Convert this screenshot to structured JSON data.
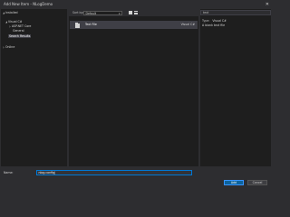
{
  "window": {
    "title": "Add New Item - NLogDemo",
    "close_glyph": "✕"
  },
  "tree": {
    "installed": "Installed",
    "visual_cs": "Visual C#",
    "aspnet_core": "ASP.NET Core",
    "general": "General",
    "search_results": "Search Results",
    "online": "Online"
  },
  "toolbar": {
    "sort_label": "Sort by:",
    "sort_value": "Default"
  },
  "templates": [
    {
      "name": "Text File",
      "type": "Visual C#"
    }
  ],
  "details": {
    "search_value": "text",
    "type_key": "Type:",
    "type_value": "Visual C#",
    "description": "A blank text file"
  },
  "form": {
    "name_label": "Name:",
    "name_value": "nlog.config|",
    "add_label": "Add",
    "cancel_label": "Cancel"
  }
}
